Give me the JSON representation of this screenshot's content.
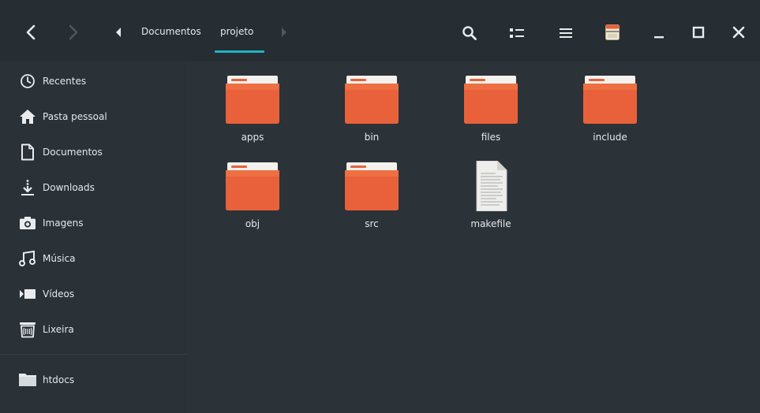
{
  "window": {
    "accent": "#1fb3c3",
    "folder_color": "#e8613a"
  },
  "header": {
    "back_icon": "chevron-left-icon",
    "forward_icon": "chevron-right-icon",
    "path_left_icon": "caret-left-icon",
    "path_right_icon": "caret-right-icon",
    "path": [
      "Documentos",
      "projeto"
    ],
    "search_icon": "search-icon",
    "view_icon": "icon-view-icon",
    "menu_icon": "hamburger-menu-icon",
    "properties_icon": "archive-icon",
    "minimize_icon": "minimize-icon",
    "maximize_icon": "maximize-icon",
    "close_icon": "close-icon"
  },
  "sidebar": {
    "items": [
      {
        "label": "Recentes",
        "icon": "clock-icon"
      },
      {
        "label": "Pasta pessoal",
        "icon": "home-icon"
      },
      {
        "label": "Documentos",
        "icon": "document-icon"
      },
      {
        "label": "Downloads",
        "icon": "download-icon"
      },
      {
        "label": "Imagens",
        "icon": "camera-icon"
      },
      {
        "label": "Música",
        "icon": "music-icon"
      },
      {
        "label": "Vídeos",
        "icon": "video-icon"
      },
      {
        "label": "Lixeira",
        "icon": "trash-icon"
      }
    ],
    "bookmarks": [
      {
        "label": "htdocs",
        "icon": "folder-icon"
      }
    ]
  },
  "files": [
    {
      "name": "apps",
      "type": "folder"
    },
    {
      "name": "bin",
      "type": "folder"
    },
    {
      "name": "files",
      "type": "folder"
    },
    {
      "name": "include",
      "type": "folder"
    },
    {
      "name": "obj",
      "type": "folder"
    },
    {
      "name": "src",
      "type": "folder"
    },
    {
      "name": "makefile",
      "type": "text-file"
    }
  ]
}
